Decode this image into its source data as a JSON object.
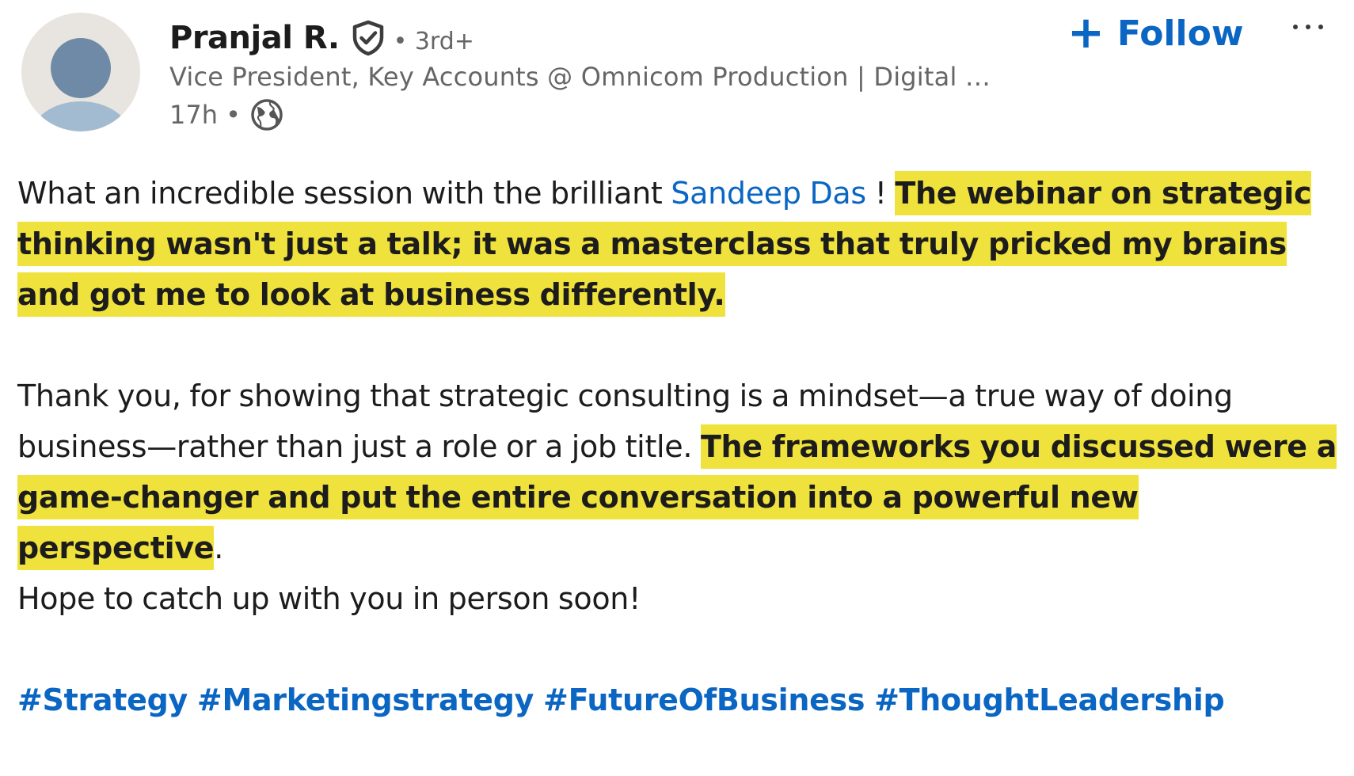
{
  "author": {
    "name": "Pranjal R.",
    "degree": "• 3rd+",
    "headline": "Vice President, Key Accounts @ Omnicom Production | Digital …",
    "time": "17h •",
    "verified_icon": "shield-check-icon",
    "visibility_icon": "globe-icon"
  },
  "actions": {
    "follow_icon": "+",
    "follow_label": "Follow",
    "more_icon": "ellipsis-icon"
  },
  "post": {
    "p1": {
      "intro": "What an incredible session with the brilliant ",
      "mention": "Sandeep Das",
      "after_mention": " ! ",
      "highlight": "The webinar on strategic thinking wasn't just a talk; it was a masterclass that truly pricked my brains and got me to look at business differently."
    },
    "p2": {
      "intro": "Thank you, for showing that strategic consulting is a mindset—a true way of doing business—rather than just a role or a job title. ",
      "highlight": "The frameworks you discussed were a game-changer and put the entire conversation into a powerful new perspective",
      "after_highlight": ".",
      "closing": "Hope to catch up with you in person soon!"
    },
    "hashtags": [
      "#Strategy",
      "#Marketingstrategy",
      "#FutureOfBusiness",
      "#ThoughtLeadership"
    ]
  },
  "colors": {
    "link_blue": "#0a66c2",
    "highlight_yellow": "#f0e23c",
    "muted_text": "#666666",
    "body_text": "#1c1c1c"
  }
}
